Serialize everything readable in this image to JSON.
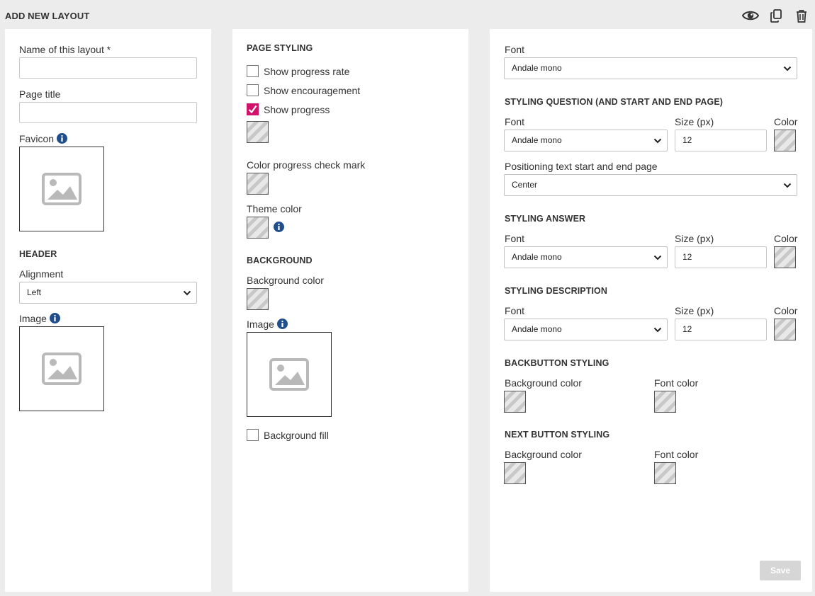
{
  "header": {
    "title": "ADD NEW LAYOUT",
    "icons": [
      "eye-icon",
      "copy-icon",
      "trash-icon"
    ]
  },
  "left": {
    "name_label": "Name of this layout *",
    "name_value": "",
    "page_title_label": "Page title",
    "page_title_value": "",
    "favicon_label": "Favicon",
    "header_section": "HEADER",
    "alignment_label": "Alignment",
    "alignment_value": "Left",
    "image_label": "Image"
  },
  "middle": {
    "page_styling": "PAGE STYLING",
    "show_progress_rate": "Show progress rate",
    "show_progress_rate_checked": false,
    "show_encouragement": "Show encouragement",
    "show_encouragement_checked": false,
    "show_progress": "Show progress",
    "show_progress_checked": true,
    "color_check_label": "Color progress check mark",
    "theme_color_label": "Theme color",
    "background_section": "BACKGROUND",
    "background_color_label": "Background color",
    "image_label": "Image",
    "background_fill": "Background fill",
    "background_fill_checked": false
  },
  "right": {
    "font_label": "Font",
    "font_value": "Andale mono",
    "question_section": "STYLING QUESTION (AND START AND END PAGE)",
    "question": {
      "font_label": "Font",
      "font_value": "Andale mono",
      "size_label": "Size (px)",
      "size_value": "12",
      "color_label": "Color"
    },
    "positioning_label": "Positioning text start and end page",
    "positioning_value": "Center",
    "answer_section": "STYLING ANSWER",
    "answer": {
      "font_label": "Font",
      "font_value": "Andale mono",
      "size_label": "Size (px)",
      "size_value": "12",
      "color_label": "Color"
    },
    "description_section": "STYLING DESCRIPTION",
    "description": {
      "font_label": "Font",
      "font_value": "Andale mono",
      "size_label": "Size (px)",
      "size_value": "12",
      "color_label": "Color"
    },
    "backbutton_section": "BACKBUTTON STYLING",
    "backbutton": {
      "bg_label": "Background color",
      "font_label": "Font color"
    },
    "nextbutton_section": "NEXT BUTTON STYLING",
    "nextbutton": {
      "bg_label": "Background color",
      "font_label": "Font color"
    },
    "save_label": "Save"
  },
  "colors": {
    "accent": "#d1136c",
    "info": "#1f4e8c",
    "panel": "#ffffff",
    "background": "#ececec"
  }
}
